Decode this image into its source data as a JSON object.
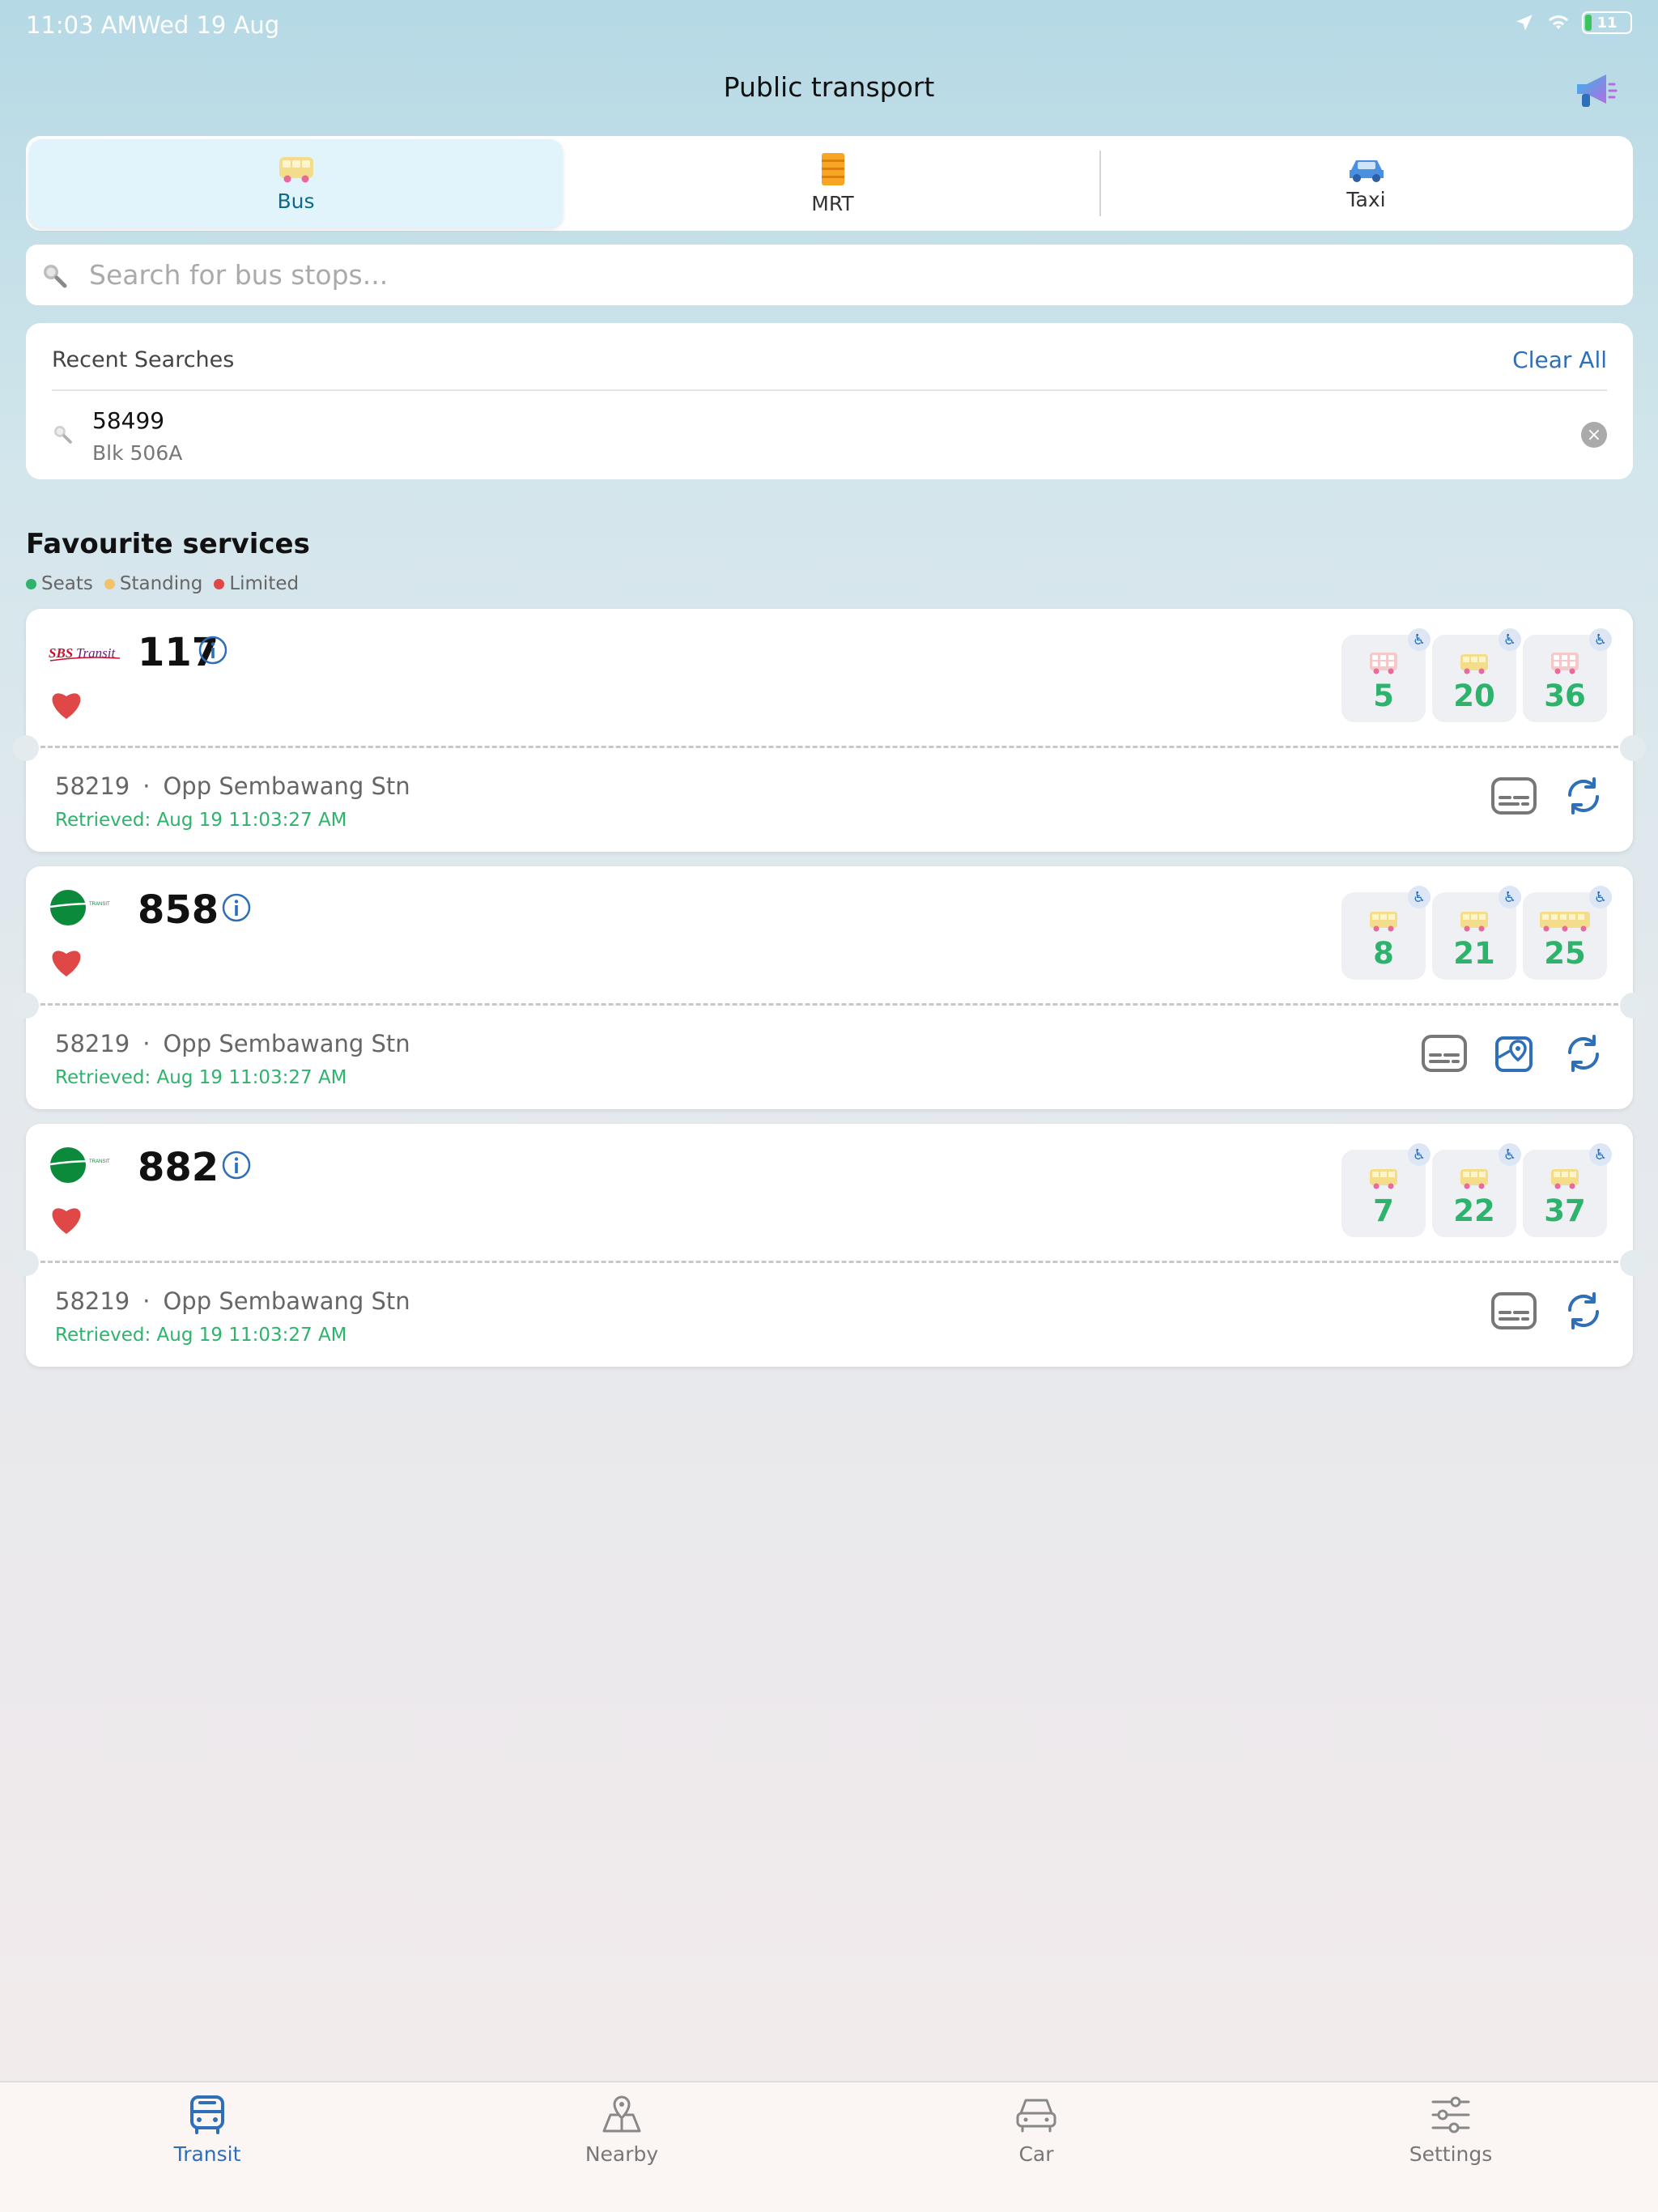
{
  "status_bar": {
    "time": "11:03 AM",
    "date": "Wed 19 Aug",
    "battery": "11"
  },
  "header": {
    "title": "Public transport"
  },
  "tabs": [
    {
      "label": "Bus",
      "icon": "bus-icon",
      "active": true
    },
    {
      "label": "MRT",
      "icon": "train-icon",
      "active": false
    },
    {
      "label": "Taxi",
      "icon": "car-icon",
      "active": false
    }
  ],
  "search": {
    "placeholder": "Search for bus stops..."
  },
  "recent": {
    "title": "Recent Searches",
    "clear_label": "Clear All",
    "items": [
      {
        "code": "58499",
        "name": "Blk 506A"
      }
    ]
  },
  "favourites": {
    "title": "Favourite services",
    "legend": [
      {
        "label": "Seats",
        "color": "#2db36c"
      },
      {
        "label": "Standing",
        "color": "#f2c26b"
      },
      {
        "label": "Limited",
        "color": "#e04848"
      }
    ],
    "services": [
      {
        "number": "117",
        "operator": "sbs-transit-logo",
        "stop_code": "58219",
        "stop_name": "Opp Sembawang Stn",
        "retrieved": "Retrieved: Aug 19 11:03:27 AM",
        "arrivals": [
          "5",
          "20",
          "36"
        ]
      },
      {
        "number": "858",
        "operator": "tower-transit-logo",
        "stop_code": "58219",
        "stop_name": "Opp Sembawang Stn",
        "retrieved": "Retrieved: Aug 19 11:03:27 AM",
        "arrivals": [
          "8",
          "21",
          "25"
        ]
      },
      {
        "number": "882",
        "operator": "tower-transit-logo",
        "stop_code": "58219",
        "stop_name": "Opp Sembawang Stn",
        "retrieved": "Retrieved: Aug 19 11:03:27 AM",
        "arrivals": [
          "7",
          "22",
          "37"
        ]
      }
    ]
  },
  "bottom_nav": [
    {
      "label": "Transit",
      "active": true
    },
    {
      "label": "Nearby",
      "active": false
    },
    {
      "label": "Car",
      "active": false
    },
    {
      "label": "Settings",
      "active": false
    }
  ],
  "colors": {
    "accent": "#2e6fb8",
    "seats": "#2db36c",
    "heart": "#e04848"
  }
}
